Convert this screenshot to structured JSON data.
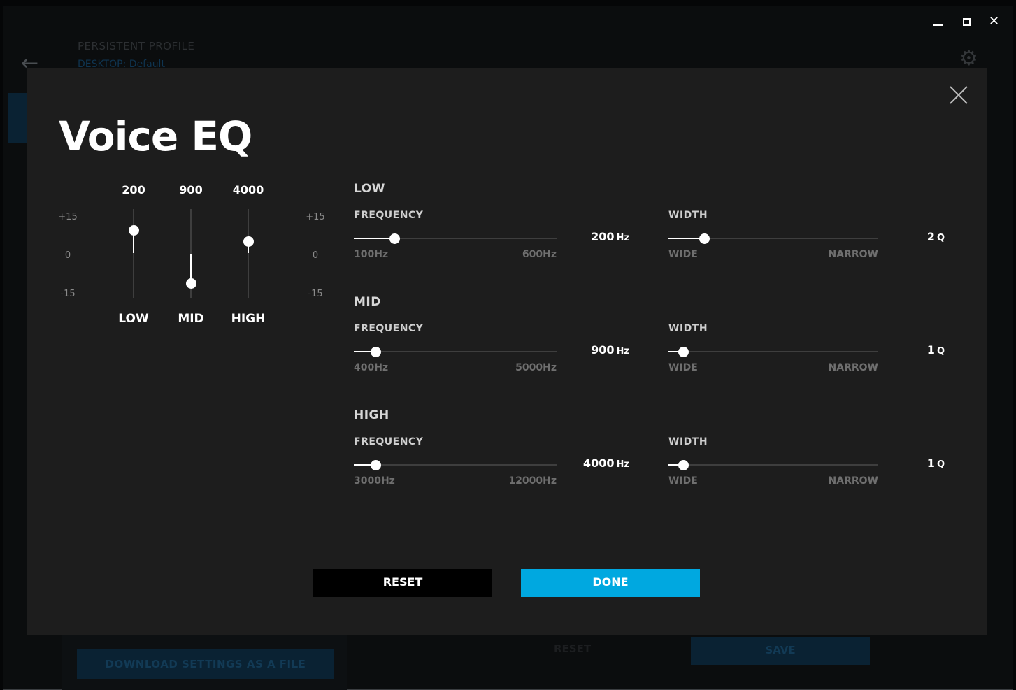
{
  "window": {
    "minimize": "–",
    "close": "✕"
  },
  "background": {
    "profile_label": "PERSISTENT PROFILE",
    "profile_sub": "DESKTOP: Default",
    "download_label": "DOWNLOAD SETTINGS AS A FILE",
    "reset_label": "RESET",
    "save_label": "SAVE"
  },
  "dialog": {
    "title": "Voice EQ",
    "scale": {
      "top": "+15",
      "mid": "0",
      "bottom": "-15"
    },
    "bands": [
      {
        "freq": "200",
        "name": "LOW",
        "gain_level": 0.76
      },
      {
        "freq": "900",
        "name": "MID",
        "gain_level": 0.16
      },
      {
        "freq": "4000",
        "name": "HIGH",
        "gain_level": 0.63
      }
    ],
    "sections": [
      {
        "name": "LOW",
        "freq_label": "FREQUENCY",
        "freq_min": "100Hz",
        "freq_max": "600Hz",
        "freq_value": "200",
        "freq_unit": "Hz",
        "freq_level": 0.2,
        "width_label": "WIDTH",
        "width_min": "WIDE",
        "width_max": "NARROW",
        "width_value": "2",
        "width_unit": "Q",
        "width_level": 0.17
      },
      {
        "name": "MID",
        "freq_label": "FREQUENCY",
        "freq_min": "400Hz",
        "freq_max": "5000Hz",
        "freq_value": "900",
        "freq_unit": "Hz",
        "freq_level": 0.11,
        "width_label": "WIDTH",
        "width_min": "WIDE",
        "width_max": "NARROW",
        "width_value": "1",
        "width_unit": "Q",
        "width_level": 0.07
      },
      {
        "name": "HIGH",
        "freq_label": "FREQUENCY",
        "freq_min": "3000Hz",
        "freq_max": "12000Hz",
        "freq_value": "4000",
        "freq_unit": "Hz",
        "freq_level": 0.11,
        "width_label": "WIDTH",
        "width_min": "WIDE",
        "width_max": "NARROW",
        "width_value": "1",
        "width_unit": "Q",
        "width_level": 0.07
      }
    ],
    "reset_label": "RESET",
    "done_label": "DONE",
    "accent": "#00a8e0"
  }
}
